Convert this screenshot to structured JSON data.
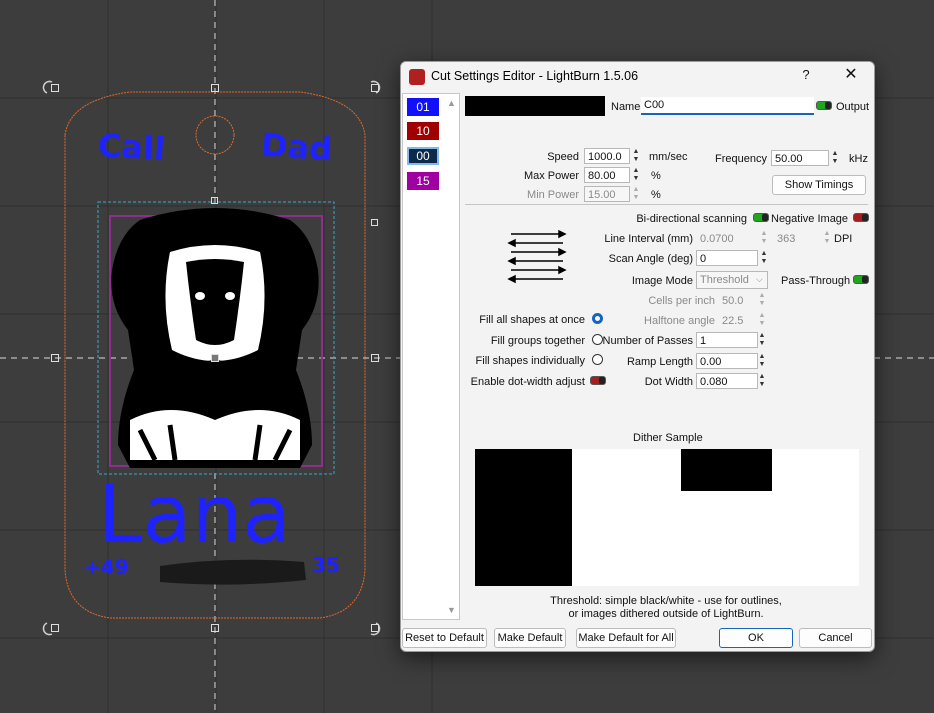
{
  "canvas": {
    "text_call": "Call",
    "text_dad": "Dad",
    "text_name": "Lana",
    "phone_prefix": "+49",
    "phone_suffix": "35",
    "colors": {
      "background": "#3d3d3d",
      "text": "#1e22ff",
      "outline": "#e06a2c",
      "image_frame": "#8e2e8e"
    }
  },
  "dialog": {
    "title": "Cut Settings Editor - LightBurn 1.5.06",
    "help": "?",
    "close": "✕",
    "layers": [
      {
        "label": "01",
        "color": "#1010ff"
      },
      {
        "label": "10",
        "color": "#a00000"
      },
      {
        "label": "00",
        "color": "#0d2a4a"
      },
      {
        "label": "15",
        "color": "#a000a0"
      }
    ],
    "name_label": "Name",
    "name_value": "C00",
    "output_label": "Output",
    "speed_label": "Speed",
    "speed_value": "1000.0",
    "speed_unit": "mm/sec",
    "frequency_label": "Frequency",
    "frequency_value": "50.00",
    "frequency_unit": "kHz",
    "max_power_label": "Max Power",
    "max_power_value": "80.00",
    "min_power_label": "Min Power",
    "min_power_value": "15.00",
    "percent": "%",
    "show_timings": "Show Timings",
    "bidirectional_label": "Bi-directional scanning",
    "negative_image_label": "Negative Image",
    "line_interval_label": "Line Interval (mm)",
    "line_interval_value": "0.0700",
    "dpi_value": "363",
    "dpi_label": "DPI",
    "scan_angle_label": "Scan Angle (deg)",
    "scan_angle_value": "0",
    "image_mode_label": "Image Mode",
    "image_mode_value": "Threshold",
    "pass_through_label": "Pass-Through",
    "cells_per_inch_label": "Cells per inch",
    "cells_per_inch_value": "50.0",
    "halftone_angle_label": "Halftone angle",
    "halftone_angle_value": "22.5",
    "fill_all_label": "Fill all shapes at once",
    "fill_groups_label": "Fill groups together",
    "fill_individually_label": "Fill shapes individually",
    "dot_width_adjust_label": "Enable dot-width adjust",
    "passes_label": "Number of Passes",
    "passes_value": "1",
    "ramp_length_label": "Ramp Length",
    "ramp_length_value": "0.00",
    "dot_width_label": "Dot Width",
    "dot_width_value": "0.080",
    "dither_title": "Dither Sample",
    "dither_caption_line1": "Threshold: simple black/white - use for outlines,",
    "dither_caption_line2": "or images dithered outside of LightBurn.",
    "buttons": {
      "reset": "Reset to Default",
      "make_default": "Make Default",
      "make_default_all": "Make Default for All",
      "ok": "OK",
      "cancel": "Cancel"
    }
  }
}
